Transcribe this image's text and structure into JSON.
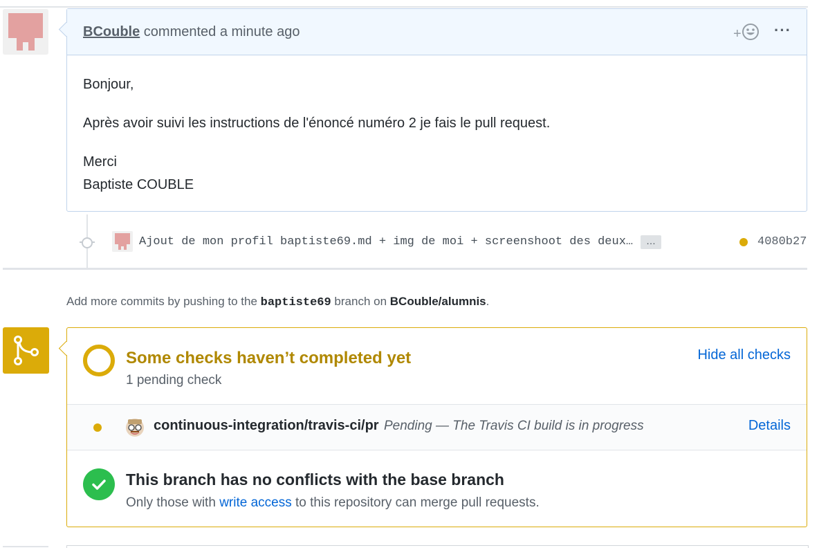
{
  "comment": {
    "author": "BCouble",
    "action": "commented a minute ago",
    "reaction_label": "+",
    "menu_label": "···",
    "body": {
      "greeting": "Bonjour,",
      "paragraph": "Après avoir suivi les instructions de l'énoncé numéro 2 je fais le pull request.",
      "signoff": "Merci",
      "signature": "Baptiste COUBLE"
    }
  },
  "commit": {
    "message": "Ajout de mon profil baptiste69.md + img de moi + screenshoot des deux…",
    "more_label": "…",
    "sha": "4080b27",
    "status_color": "#dbab09"
  },
  "push_hint": {
    "prefix": "Add more commits by pushing to the",
    "branch": "baptiste69",
    "middle": "branch on",
    "repo": "BCouble/alumnis",
    "suffix": "."
  },
  "checks": {
    "title": "Some checks haven’t completed yet",
    "subtitle": "1 pending check",
    "toggle_label": "Hide all checks",
    "items": [
      {
        "name": "continuous-integration/travis-ci/pr",
        "description": "Pending — The Travis CI build is in progress",
        "details_label": "Details"
      }
    ]
  },
  "merge": {
    "title": "This branch has no conflicts with the base branch",
    "sub_prefix": "Only those with",
    "sub_link": "write access",
    "sub_suffix": "to this repository can merge pull requests."
  },
  "colors": {
    "pending": "#dbab09",
    "pending_text": "#b08800",
    "success": "#2cbe4e",
    "link": "#0366d6",
    "header_bg": "#f1f8ff"
  },
  "icons": {
    "reaction": "smiley-icon",
    "merge": "git-merge-icon",
    "success": "check-icon",
    "ci": "travis-ci-icon"
  }
}
